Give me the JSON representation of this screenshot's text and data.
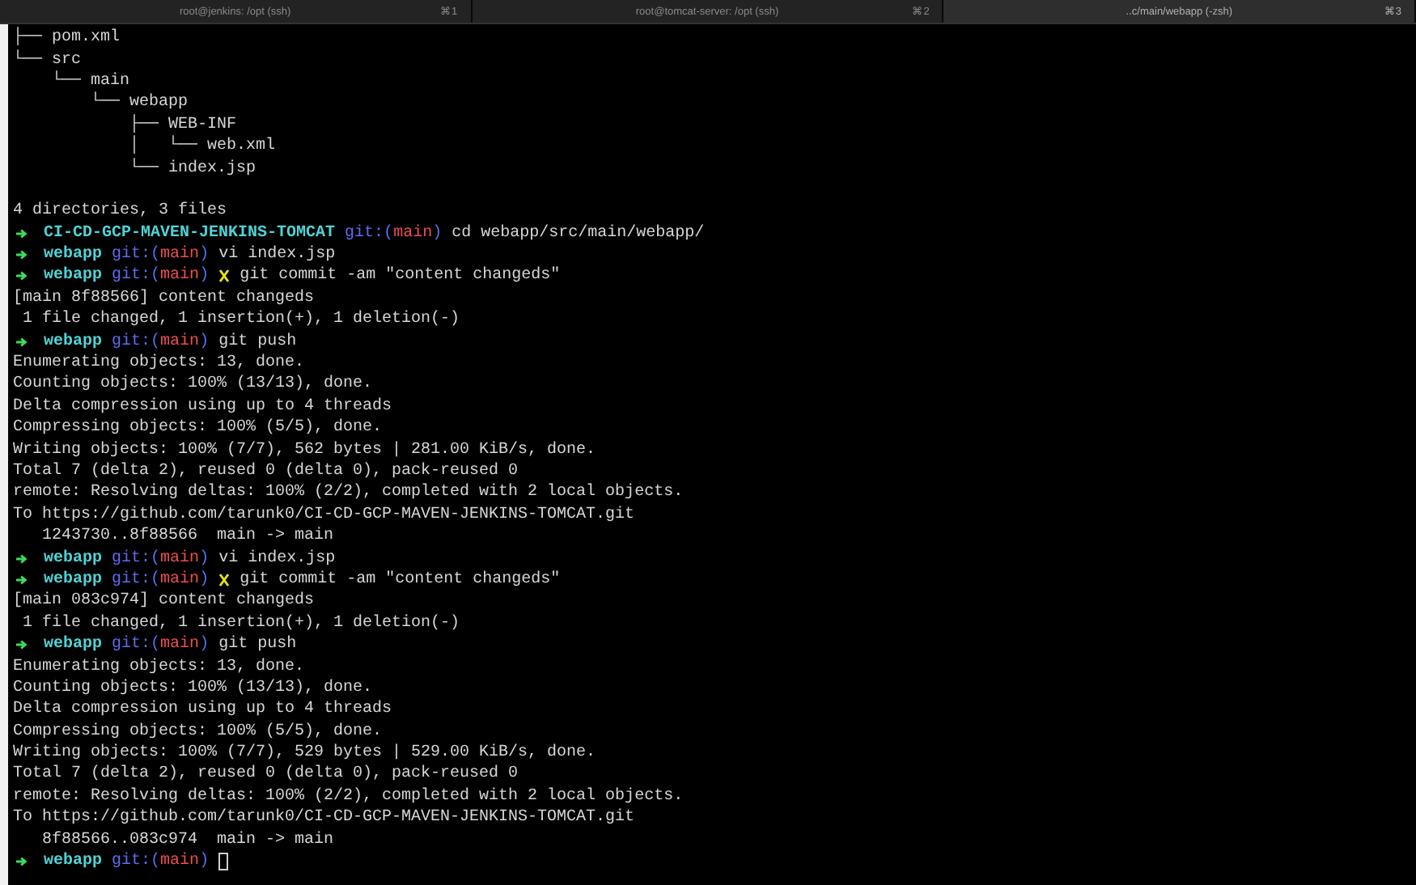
{
  "tabs": [
    {
      "title": "root@jenkins: /opt (ssh)",
      "shortcut": "⌘1",
      "selected": false
    },
    {
      "title": "root@tomcat-server: /opt (ssh)",
      "shortcut": "⌘2",
      "selected": false
    },
    {
      "title": "..c/main/webapp (-zsh)",
      "shortcut": "⌘3",
      "selected": true
    }
  ],
  "lines": [
    {
      "kind": "out",
      "text": "├── pom.xml"
    },
    {
      "kind": "out",
      "text": "└── src"
    },
    {
      "kind": "out",
      "text": "    └── main"
    },
    {
      "kind": "out",
      "text": "        └── webapp"
    },
    {
      "kind": "out",
      "text": "            ├── WEB-INF"
    },
    {
      "kind": "out",
      "text": "            │   └── web.xml"
    },
    {
      "kind": "out",
      "text": "            └── index.jsp"
    },
    {
      "kind": "blank"
    },
    {
      "kind": "out",
      "text": "4 directories, 3 files"
    },
    {
      "kind": "prompt",
      "dir": "CI-CD-GCP-MAVEN-JENKINS-TOMCAT",
      "git_open": "git:(",
      "branch": "main",
      "git_close": ")",
      "dirty": false,
      "command": "cd webapp/src/main/webapp/",
      "cursor": false
    },
    {
      "kind": "prompt",
      "dir": "webapp",
      "git_open": "git:(",
      "branch": "main",
      "git_close": ")",
      "dirty": false,
      "command": "vi index.jsp",
      "cursor": false
    },
    {
      "kind": "prompt",
      "dir": "webapp",
      "git_open": "git:(",
      "branch": "main",
      "git_close": ")",
      "dirty": true,
      "command": "git commit -am \"content changeds\"",
      "cursor": false
    },
    {
      "kind": "out",
      "text": "[main 8f88566] content changeds"
    },
    {
      "kind": "out",
      "text": " 1 file changed, 1 insertion(+), 1 deletion(-)"
    },
    {
      "kind": "prompt",
      "dir": "webapp",
      "git_open": "git:(",
      "branch": "main",
      "git_close": ")",
      "dirty": false,
      "command": "git push",
      "cursor": false
    },
    {
      "kind": "out",
      "text": "Enumerating objects: 13, done."
    },
    {
      "kind": "out",
      "text": "Counting objects: 100% (13/13), done."
    },
    {
      "kind": "out",
      "text": "Delta compression using up to 4 threads"
    },
    {
      "kind": "out",
      "text": "Compressing objects: 100% (5/5), done."
    },
    {
      "kind": "out",
      "text": "Writing objects: 100% (7/7), 562 bytes | 281.00 KiB/s, done."
    },
    {
      "kind": "out",
      "text": "Total 7 (delta 2), reused 0 (delta 0), pack-reused 0"
    },
    {
      "kind": "out",
      "text": "remote: Resolving deltas: 100% (2/2), completed with 2 local objects."
    },
    {
      "kind": "out",
      "text": "To https://github.com/tarunk0/CI-CD-GCP-MAVEN-JENKINS-TOMCAT.git"
    },
    {
      "kind": "out",
      "text": "   1243730..8f88566  main -> main"
    },
    {
      "kind": "prompt",
      "dir": "webapp",
      "git_open": "git:(",
      "branch": "main",
      "git_close": ")",
      "dirty": false,
      "command": "vi index.jsp",
      "cursor": false
    },
    {
      "kind": "prompt",
      "dir": "webapp",
      "git_open": "git:(",
      "branch": "main",
      "git_close": ")",
      "dirty": true,
      "command": "git commit -am \"content changeds\"",
      "cursor": false
    },
    {
      "kind": "out",
      "text": "[main 083c974] content changeds"
    },
    {
      "kind": "out",
      "text": " 1 file changed, 1 insertion(+), 1 deletion(-)"
    },
    {
      "kind": "prompt",
      "dir": "webapp",
      "git_open": "git:(",
      "branch": "main",
      "git_close": ")",
      "dirty": false,
      "command": "git push",
      "cursor": false
    },
    {
      "kind": "out",
      "text": "Enumerating objects: 13, done."
    },
    {
      "kind": "out",
      "text": "Counting objects: 100% (13/13), done."
    },
    {
      "kind": "out",
      "text": "Delta compression using up to 4 threads"
    },
    {
      "kind": "out",
      "text": "Compressing objects: 100% (5/5), done."
    },
    {
      "kind": "out",
      "text": "Writing objects: 100% (7/7), 529 bytes | 529.00 KiB/s, done."
    },
    {
      "kind": "out",
      "text": "Total 7 (delta 2), reused 0 (delta 0), pack-reused 0"
    },
    {
      "kind": "out",
      "text": "remote: Resolving deltas: 100% (2/2), completed with 2 local objects."
    },
    {
      "kind": "out",
      "text": "To https://github.com/tarunk0/CI-CD-GCP-MAVEN-JENKINS-TOMCAT.git"
    },
    {
      "kind": "out",
      "text": "   8f88566..083c974  main -> main"
    },
    {
      "kind": "prompt",
      "dir": "webapp",
      "git_open": "git:(",
      "branch": "main",
      "git_close": ")",
      "dirty": false,
      "cursor": true
    }
  ]
}
